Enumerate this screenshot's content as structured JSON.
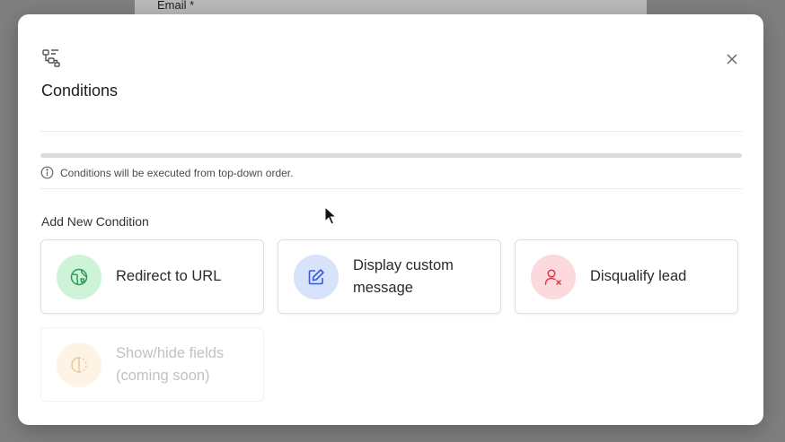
{
  "background": {
    "field_label": "Email *"
  },
  "modal": {
    "title": "Conditions",
    "close_icon": "close-icon",
    "header_icon": "conditions-icon",
    "info_text": "Conditions will be executed from top-down order.",
    "add_label": "Add New Condition",
    "options": [
      {
        "label": "Redirect to URL",
        "icon": "globe-icon",
        "color": "#cdf3d9",
        "stroke": "#2e9a5a",
        "enabled": true
      },
      {
        "label": "Display custom message",
        "icon": "edit-icon",
        "color": "#d7e2fb",
        "stroke": "#3b5bd9",
        "enabled": true
      },
      {
        "label": "Disqualify lead",
        "icon": "user-x-icon",
        "color": "#fbd9dc",
        "stroke": "#d9394b",
        "enabled": true
      },
      {
        "label": "Show/hide fields (coming soon)",
        "icon": "half-circle-icon",
        "color": "#fbe8c7",
        "stroke": "#c98a2b",
        "enabled": false
      }
    ]
  }
}
